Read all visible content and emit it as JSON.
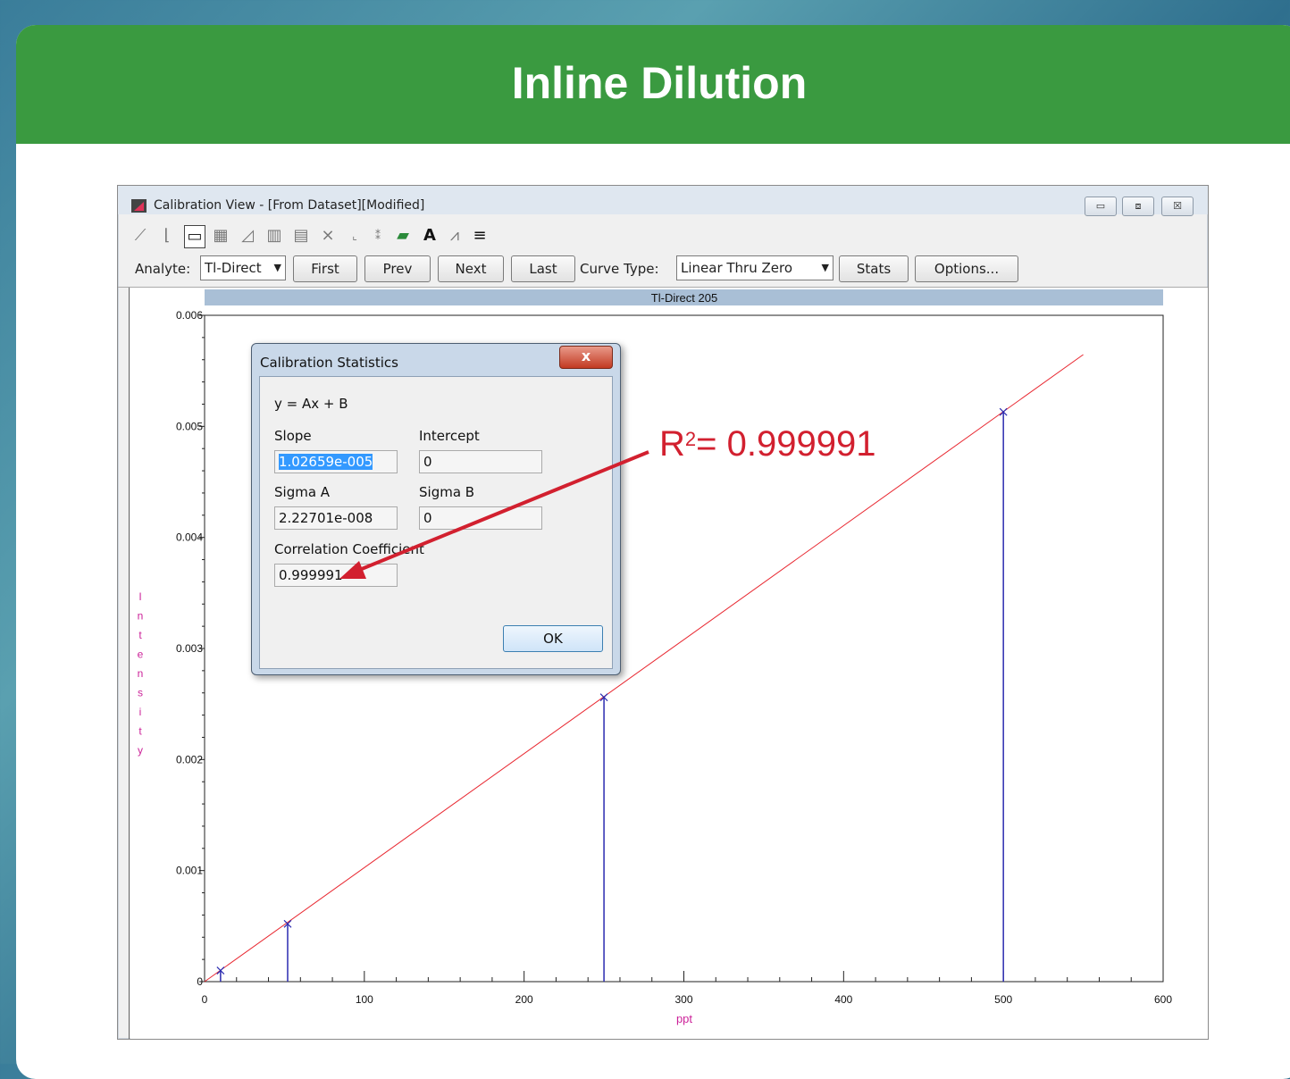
{
  "slide": {
    "title": "Inline Dilution"
  },
  "window": {
    "title": "Calibration View -  [From Dataset][Modified]",
    "controls": {
      "minimize": "▭",
      "maximize": "⧈",
      "close": "☒"
    }
  },
  "toolbar": {
    "icons": [
      "line-chart-icon",
      "line-chart-2-icon",
      "frame-icon",
      "grid-icon",
      "curve-icon",
      "bar-chart-icon",
      "bar-chart-2-icon",
      "scatter-icon",
      "small-line-icon",
      "dots-icon",
      "color-layers-icon",
      "font-icon",
      "peak-icon",
      "lines-icon"
    ]
  },
  "controls": {
    "analyte_label": "Analyte:",
    "analyte_value": "Tl-Direct",
    "first": "First",
    "prev": "Prev",
    "next": "Next",
    "last": "Last",
    "curve_type_label": "Curve Type:",
    "curve_type_value": "Linear Thru Zero",
    "stats": "Stats",
    "options": "Options..."
  },
  "chart_data": {
    "type": "scatter",
    "title": "Tl-Direct 205",
    "xlabel": "ppt",
    "ylabel": "Intensity",
    "xlim": [
      0,
      600
    ],
    "ylim": [
      0,
      0.006
    ],
    "xticks": [
      "0",
      "100",
      "200",
      "300",
      "400",
      "500",
      "600"
    ],
    "yticks": [
      "0",
      "0.001",
      "0.002",
      "0.003",
      "0.004",
      "0.005",
      "0.006"
    ],
    "points": [
      {
        "x": 10,
        "y": 0.0001
      },
      {
        "x": 52,
        "y": 0.00052
      },
      {
        "x": 250,
        "y": 0.00256
      },
      {
        "x": 500,
        "y": 0.00513
      }
    ],
    "fit_line": {
      "slope": 1.02659e-05,
      "intercept": 0,
      "x_end": 550
    },
    "colors": {
      "points": "#2b2bb0",
      "fit": "#e8262f",
      "title_bar": "#a9bfd6",
      "axis_label": "#cc2299"
    }
  },
  "dialog": {
    "title": "Calibration Statistics",
    "close": "x",
    "equation": "y = Ax + B",
    "slope_label": "Slope",
    "slope_value": "1.02659e-005",
    "intercept_label": "Intercept",
    "intercept_value": "0",
    "sigma_a_label": "Sigma A",
    "sigma_a_value": "2.22701e-008",
    "sigma_b_label": "Sigma B",
    "sigma_b_value": "0",
    "corr_label": "Correlation Coefficient",
    "corr_value": "0.999991",
    "ok": "OK"
  },
  "annotation": {
    "r2_label": "R",
    "r2_sup": "2",
    "r2_value": "= 0.999991",
    "color": "#d2202f"
  }
}
